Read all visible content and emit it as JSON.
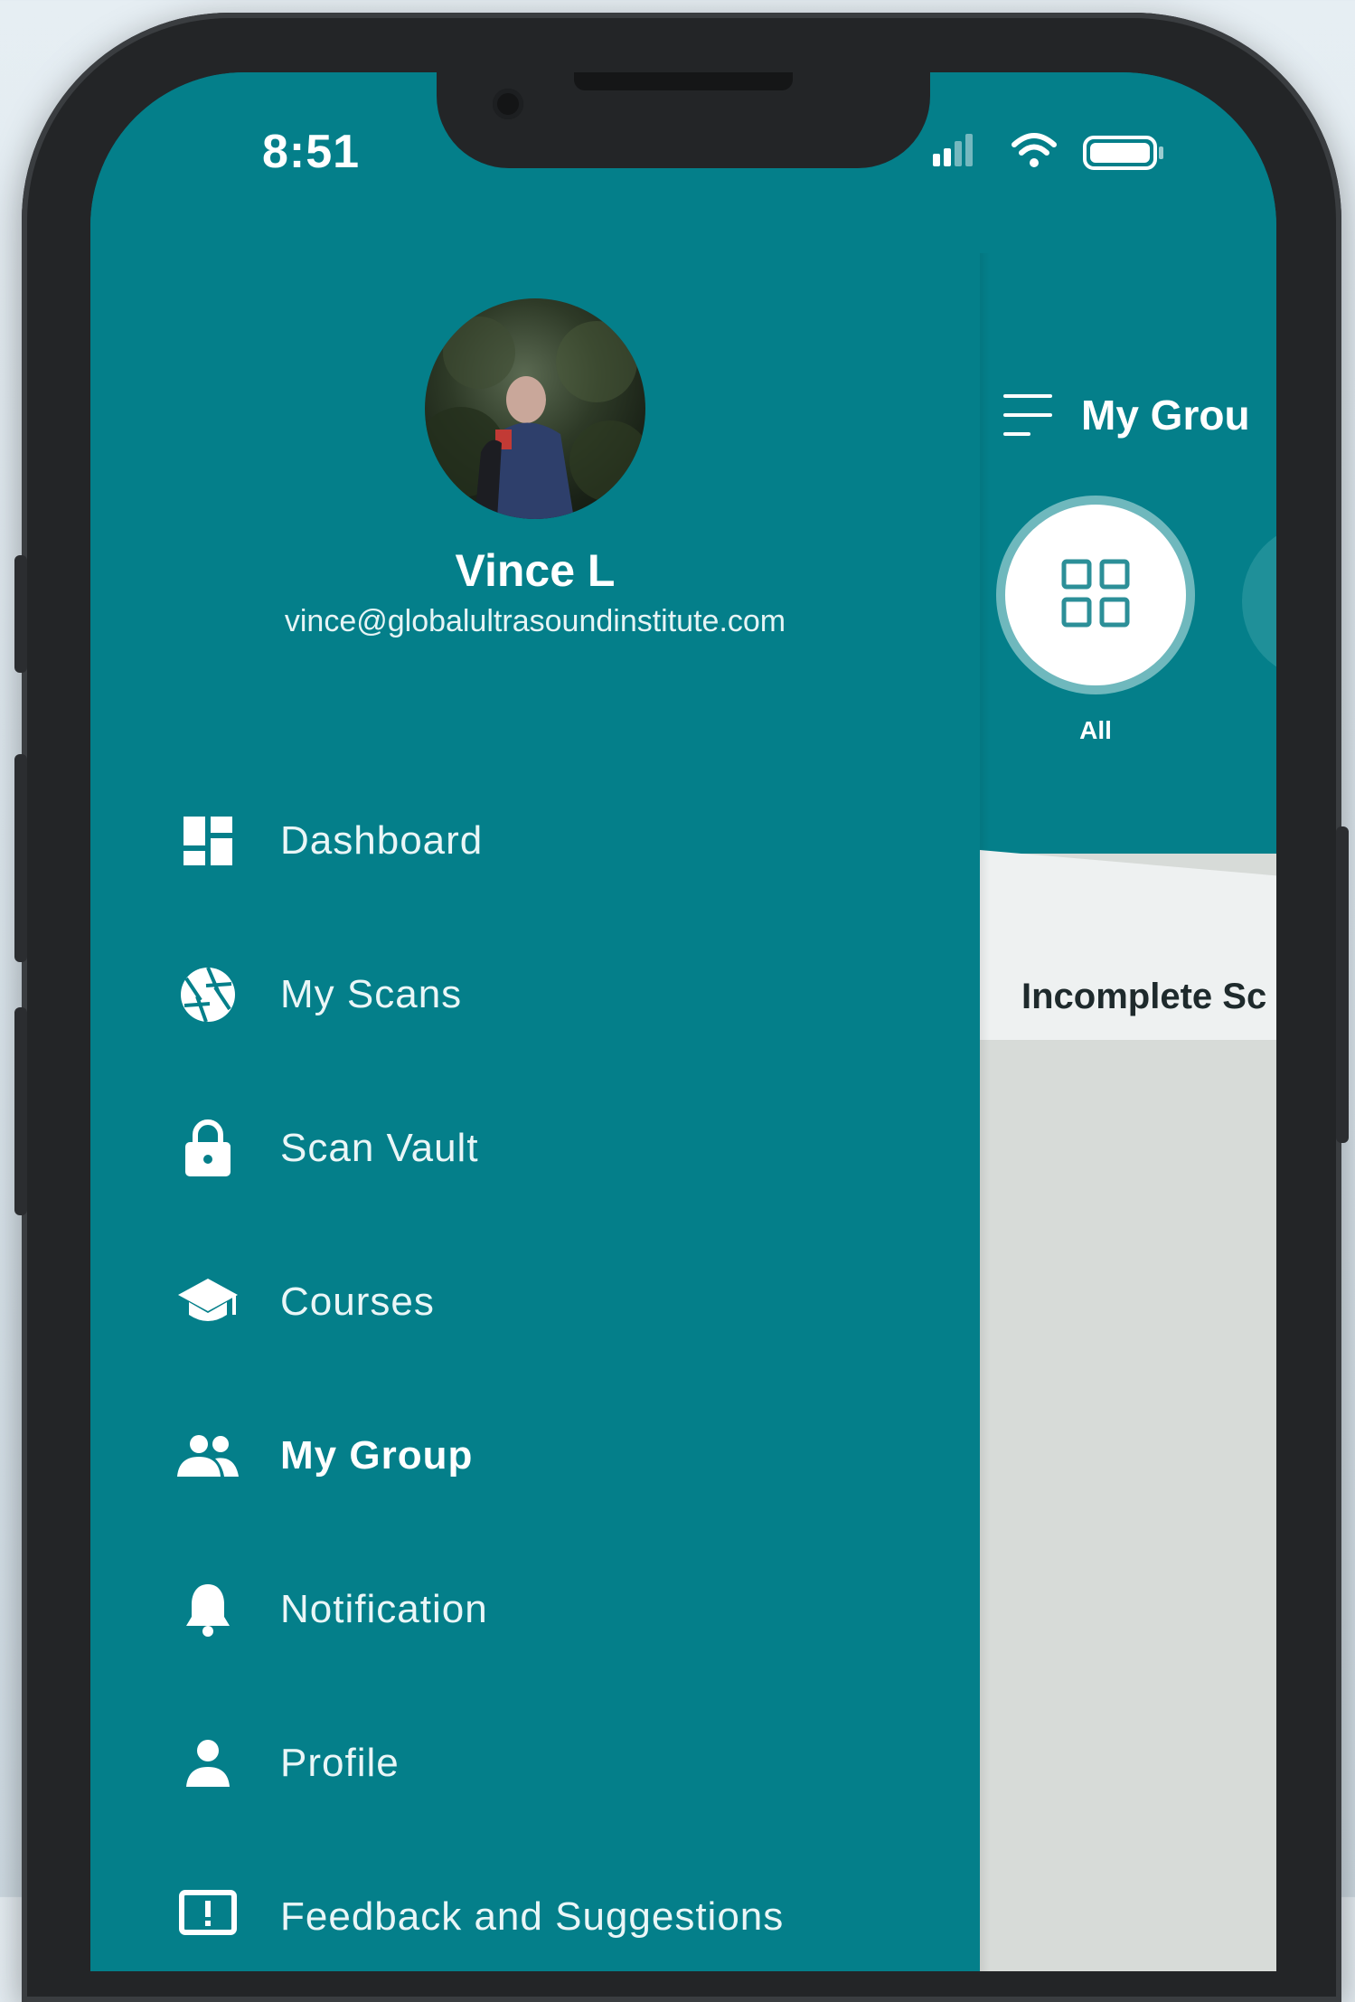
{
  "status_bar": {
    "time": "8:51"
  },
  "profile": {
    "name": "Vince L",
    "email": "vince@globalultrasoundinstitute.com"
  },
  "menu": {
    "items": [
      {
        "label": "Dashboard",
        "icon": "dashboard-icon"
      },
      {
        "label": "My Scans",
        "icon": "aperture-icon"
      },
      {
        "label": "Scan Vault",
        "icon": "lock-icon"
      },
      {
        "label": "Courses",
        "icon": "graduation-cap-icon"
      },
      {
        "label": "My Group",
        "icon": "group-icon",
        "active": true
      },
      {
        "label": "Notification",
        "icon": "bell-icon"
      },
      {
        "label": "Profile",
        "icon": "person-icon"
      },
      {
        "label": "Feedback and Suggestions",
        "icon": "feedback-icon"
      }
    ]
  },
  "main": {
    "title": "My Grou",
    "filters": [
      {
        "label": "All",
        "icon": "grid-icon"
      }
    ],
    "section_label": "Incomplete Sc"
  },
  "colors": {
    "primary": "#047f8a",
    "sheet": "#d7dbd8",
    "sheet_header": "#eef1f1"
  }
}
